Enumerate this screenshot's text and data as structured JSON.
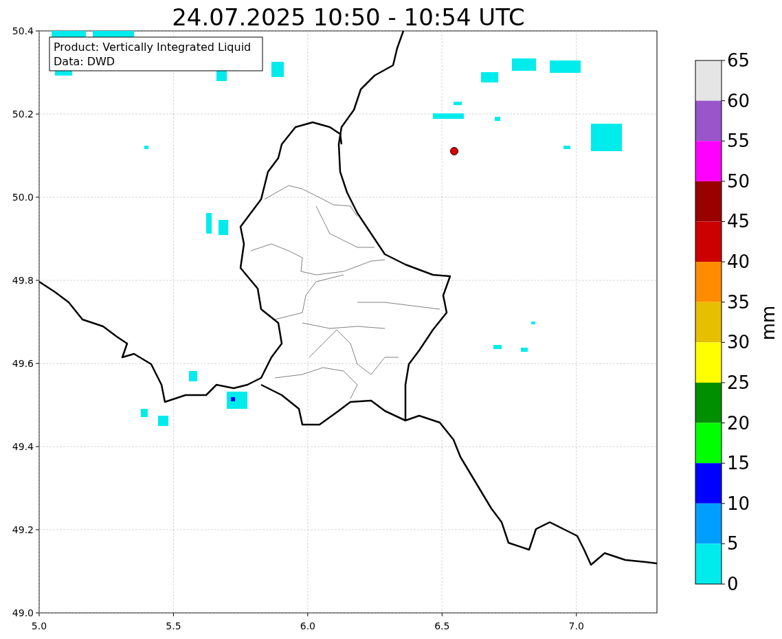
{
  "title": "24.07.2025 10:50 - 10:54 UTC",
  "info_box": [
    "Product: Vertically Integrated Liquid",
    "Data: DWD"
  ],
  "x_axis": {
    "ticks": [
      "5.0",
      "5.5",
      "6.0",
      "6.5",
      "7.0"
    ]
  },
  "y_axis": {
    "ticks": [
      "50.4",
      "50.2",
      "50.0",
      "49.8",
      "49.6",
      "49.4",
      "49.2",
      "49.0"
    ]
  },
  "colorbar": {
    "label": "mm",
    "ticks": [
      "65",
      "60",
      "55",
      "50",
      "45",
      "40",
      "35",
      "30",
      "25",
      "20",
      "15",
      "10",
      "5",
      "0"
    ],
    "bins": [
      {
        "color": "#e5e5e5"
      },
      {
        "color": "#9955c9"
      },
      {
        "color": "#ff00ff"
      },
      {
        "color": "#990000"
      },
      {
        "color": "#cc0000"
      },
      {
        "color": "#ff8c00"
      },
      {
        "color": "#e6bf00"
      },
      {
        "color": "#ffff00"
      },
      {
        "color": "#008f00"
      },
      {
        "color": "#00ff00"
      },
      {
        "color": "#0000ff"
      },
      {
        "color": "#009fff"
      },
      {
        "color": "#00ecec"
      }
    ]
  }
}
